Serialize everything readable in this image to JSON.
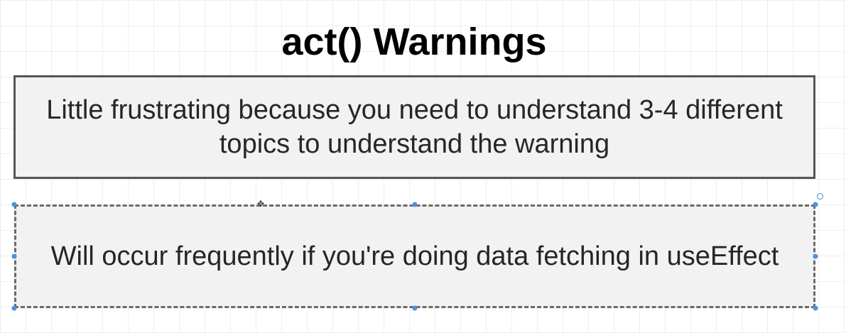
{
  "title": "act() Warnings",
  "boxes": [
    {
      "text": "Little frustrating because you need to understand 3-4 different topics to understand the warning"
    },
    {
      "text": "Will occur frequently if you're doing data fetching in useEffect"
    }
  ],
  "colors": {
    "box_fill": "#f2f2f2",
    "box_border": "#555555",
    "selection_handle": "#4a90e2",
    "text": "#262626"
  },
  "selection": {
    "selected_box": "box-2",
    "move_icon": "move-icon",
    "rotate_icon": "rotate-handle-icon"
  }
}
